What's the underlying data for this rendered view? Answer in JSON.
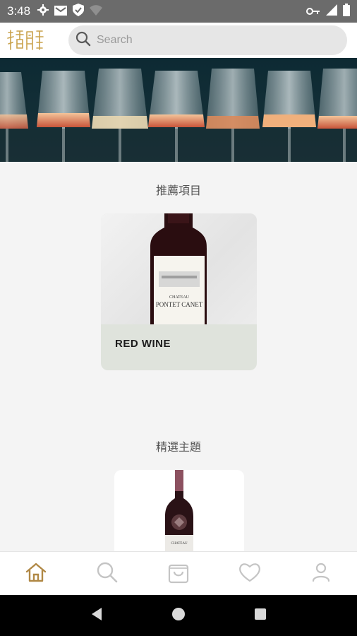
{
  "status_bar": {
    "time": "3:48",
    "left_icons": [
      "gear-icon",
      "mail-icon",
      "shield-icon",
      "wifi-off-icon"
    ],
    "right_icons": [
      "key-icon",
      "signal-icon",
      "battery-icon"
    ]
  },
  "header": {
    "logo_text": "法蘭克酒莊",
    "search": {
      "placeholder": "Search",
      "value": ""
    }
  },
  "sections": {
    "recommended": {
      "title": "推薦項目",
      "card_label": "RED WINE",
      "bottle_label_line1": "CHATEAU",
      "bottle_label_line2": "PONTET CANET"
    },
    "featured": {
      "title": "精選主題",
      "bottle_label": "CHATEAU"
    }
  },
  "bottom_nav": [
    {
      "icon": "home-icon",
      "active": true
    },
    {
      "icon": "search-icon",
      "active": false
    },
    {
      "icon": "bag-icon",
      "active": false
    },
    {
      "icon": "heart-icon",
      "active": false
    },
    {
      "icon": "user-icon",
      "active": false
    }
  ],
  "colors": {
    "accent": "#b08845",
    "nav_inactive": "#c4c4c4",
    "card_bg": "#dfe3dc",
    "status_bar": "#6b6b6b"
  }
}
